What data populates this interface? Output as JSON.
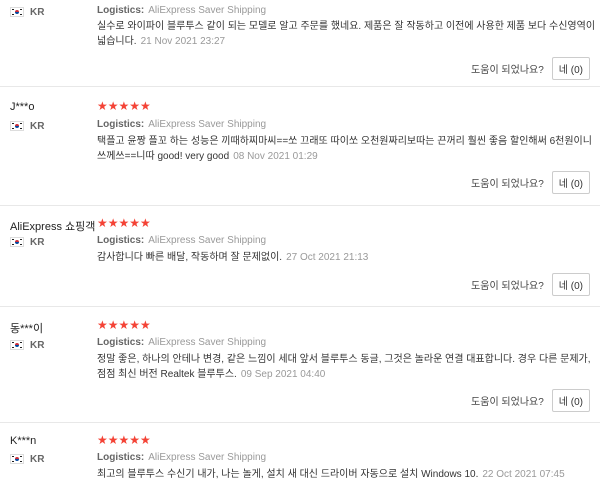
{
  "reviews": [
    {
      "user": "",
      "country": "KR",
      "stars": "",
      "logistics_label": "Logistics:",
      "logistics_value": "AliExpress Saver Shipping",
      "text": "실수로 와이파이 블루투스 같이 되는 모델로 알고 주문를 했네요. 제품은 잘 작동하고 이전에 사용한 제품 보다 수신영역이 넓습니다.",
      "date": "21 Nov 2021 23:27",
      "helpful_q": "도움이 되었나요?",
      "helpful_btn": "네 (0)"
    },
    {
      "user": "J***o",
      "country": "KR",
      "stars": "★★★★★",
      "logistics_label": "Logistics:",
      "logistics_value": "AliExpress Saver Shipping",
      "text": "택플고 윤짱 플꼬 하는 성능은 끼때하찌마씨==쏘 끄래또 따이쏘 오천원짜리보따는 끈꺼리 훨씬 좋음 할인해써 6천원이니 쓰께쓰==니따 good! very good",
      "date": "08 Nov 2021 01:29",
      "helpful_q": "도움이 되었나요?",
      "helpful_btn": "네 (0)"
    },
    {
      "user": "AliExpress 쇼핑객",
      "country": "KR",
      "stars": "★★★★★",
      "logistics_label": "Logistics:",
      "logistics_value": "AliExpress Saver Shipping",
      "text": "감사합니다 빠른 배달, 작동하며 잘 문제없이.",
      "date": "27 Oct 2021 21:13",
      "helpful_q": "도움이 되었나요?",
      "helpful_btn": "네 (0)"
    },
    {
      "user": "동***이",
      "country": "KR",
      "stars": "★★★★★",
      "logistics_label": "Logistics:",
      "logistics_value": "AliExpress Saver Shipping",
      "text": "정말 좋은, 하나의 안테나 변경, 같은 느낌이 세대 앞서 블루투스 동글, 그것은 놀라운 연결 대표합니다. 경우 다른 문제가, 점점 최신 버전 Realtek 블루투스.",
      "date": "09 Sep 2021 04:40",
      "helpful_q": "도움이 되었나요?",
      "helpful_btn": "네 (0)"
    },
    {
      "user": "K***n",
      "country": "KR",
      "stars": "★★★★★",
      "logistics_label": "Logistics:",
      "logistics_value": "AliExpress Saver Shipping",
      "text": "최고의 블루투스 수신기 내가, 나는 놀게, 설치 새 대신 드라이버 자동으로 설치 Windows 10.",
      "date": "22 Oct 2021 07:45",
      "helpful_q": "",
      "helpful_btn": ""
    }
  ]
}
